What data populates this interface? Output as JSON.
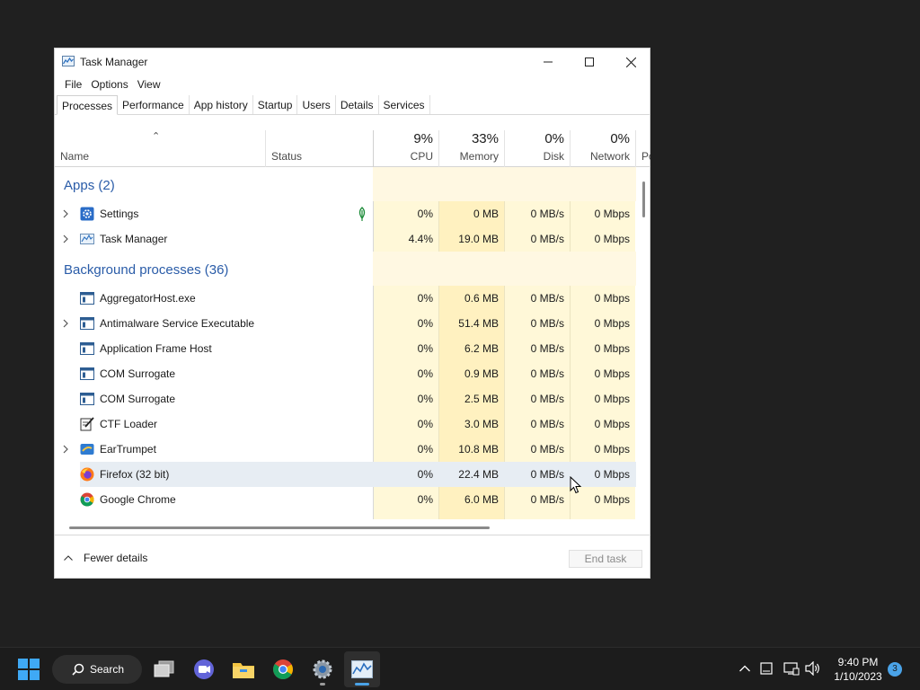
{
  "window": {
    "title": "Task Manager"
  },
  "menu": [
    "File",
    "Options",
    "View"
  ],
  "tabs": [
    "Processes",
    "Performance",
    "App history",
    "Startup",
    "Users",
    "Details",
    "Services"
  ],
  "columns": {
    "name": "Name",
    "status": "Status",
    "cpu": {
      "pct": "9%",
      "label": "CPU"
    },
    "memory": {
      "pct": "33%",
      "label": "Memory"
    },
    "disk": {
      "pct": "0%",
      "label": "Disk"
    },
    "network": {
      "pct": "0%",
      "label": "Network"
    },
    "power": {
      "label": "Po"
    }
  },
  "groups": {
    "apps": {
      "label": "Apps (2)",
      "rows": [
        {
          "name": "Settings",
          "expandable": true,
          "icon": "settings-icon",
          "status_icon": "leaf-icon",
          "cpu": "0%",
          "memory": "0 MB",
          "disk": "0 MB/s",
          "network": "0 Mbps"
        },
        {
          "name": "Task Manager",
          "expandable": true,
          "icon": "task-manager-icon",
          "cpu": "4.4%",
          "memory": "19.0 MB",
          "disk": "0 MB/s",
          "network": "0 Mbps"
        }
      ]
    },
    "background": {
      "label": "Background processes (36)",
      "rows": [
        {
          "name": "AggregatorHost.exe",
          "expandable": false,
          "icon": "app-window-icon",
          "cpu": "0%",
          "memory": "0.6 MB",
          "disk": "0 MB/s",
          "network": "0 Mbps"
        },
        {
          "name": "Antimalware Service Executable",
          "expandable": true,
          "icon": "app-window-icon",
          "cpu": "0%",
          "memory": "51.4 MB",
          "disk": "0 MB/s",
          "network": "0 Mbps"
        },
        {
          "name": "Application Frame Host",
          "expandable": false,
          "icon": "app-window-icon",
          "cpu": "0%",
          "memory": "6.2 MB",
          "disk": "0 MB/s",
          "network": "0 Mbps"
        },
        {
          "name": "COM Surrogate",
          "expandable": false,
          "icon": "app-window-icon",
          "cpu": "0%",
          "memory": "0.9 MB",
          "disk": "0 MB/s",
          "network": "0 Mbps"
        },
        {
          "name": "COM Surrogate",
          "expandable": false,
          "icon": "app-window-icon",
          "cpu": "0%",
          "memory": "2.5 MB",
          "disk": "0 MB/s",
          "network": "0 Mbps"
        },
        {
          "name": "CTF Loader",
          "expandable": false,
          "icon": "notepad-pen-icon",
          "cpu": "0%",
          "memory": "3.0 MB",
          "disk": "0 MB/s",
          "network": "0 Mbps"
        },
        {
          "name": "EarTrumpet",
          "expandable": true,
          "icon": "eartrumpet-icon",
          "cpu": "0%",
          "memory": "10.8 MB",
          "disk": "0 MB/s",
          "network": "0 Mbps"
        },
        {
          "name": "Firefox (32 bit)",
          "expandable": false,
          "icon": "firefox-icon",
          "selected": true,
          "cpu": "0%",
          "memory": "22.4 MB",
          "disk": "0 MB/s",
          "network": "0 Mbps"
        },
        {
          "name": "Google Chrome",
          "expandable": false,
          "icon": "chrome-icon",
          "cpu": "0%",
          "memory": "6.0 MB",
          "disk": "0 MB/s",
          "network": "0 Mbps"
        }
      ]
    }
  },
  "footer": {
    "fewer_details": "Fewer details",
    "end_task": "End task"
  },
  "taskbar": {
    "search_label": "Search",
    "time": "9:40 PM",
    "date": "1/10/2023",
    "notification_count": "3",
    "accent": "#4aa3e8"
  },
  "colors": {
    "group_label": "#2a5ca8",
    "heat_light": "#fff8d8",
    "heat_memory": "#fff1c0",
    "selected_row": "#e7edf3"
  }
}
